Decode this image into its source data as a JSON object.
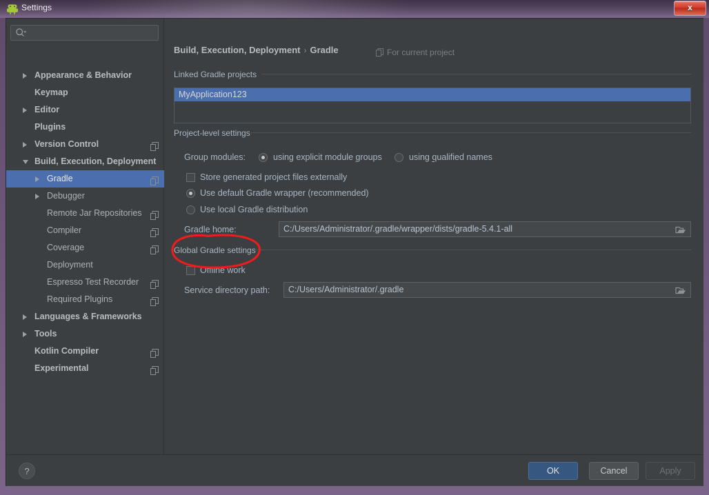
{
  "window": {
    "title": "Settings",
    "app_icon": "android-icon",
    "close_label": "x"
  },
  "sidebar": {
    "search": {
      "placeholder": "",
      "value": "",
      "icon": "search-icon"
    },
    "items": [
      {
        "label": "Appearance & Behavior",
        "indent": 0,
        "arrow": "right",
        "bold": true,
        "badge": false
      },
      {
        "label": "Keymap",
        "indent": 0,
        "arrow": "none",
        "bold": true,
        "badge": false
      },
      {
        "label": "Editor",
        "indent": 0,
        "arrow": "right",
        "bold": true,
        "badge": false
      },
      {
        "label": "Plugins",
        "indent": 0,
        "arrow": "none",
        "bold": true,
        "badge": false
      },
      {
        "label": "Version Control",
        "indent": 0,
        "arrow": "right",
        "bold": true,
        "badge": true
      },
      {
        "label": "Build, Execution, Deployment",
        "indent": 0,
        "arrow": "down",
        "bold": true,
        "badge": false
      },
      {
        "label": "Gradle",
        "indent": 1,
        "arrow": "right",
        "bold": false,
        "badge": true,
        "selected": true
      },
      {
        "label": "Debugger",
        "indent": 1,
        "arrow": "right",
        "bold": false,
        "badge": false
      },
      {
        "label": "Remote Jar Repositories",
        "indent": 1,
        "arrow": "none",
        "bold": false,
        "badge": true
      },
      {
        "label": "Compiler",
        "indent": 1,
        "arrow": "none",
        "bold": false,
        "badge": true
      },
      {
        "label": "Coverage",
        "indent": 1,
        "arrow": "none",
        "bold": false,
        "badge": true
      },
      {
        "label": "Deployment",
        "indent": 1,
        "arrow": "none",
        "bold": false,
        "badge": false
      },
      {
        "label": "Espresso Test Recorder",
        "indent": 1,
        "arrow": "none",
        "bold": false,
        "badge": true
      },
      {
        "label": "Required Plugins",
        "indent": 1,
        "arrow": "none",
        "bold": false,
        "badge": true
      },
      {
        "label": "Languages & Frameworks",
        "indent": 0,
        "arrow": "right",
        "bold": true,
        "badge": false
      },
      {
        "label": "Tools",
        "indent": 0,
        "arrow": "right",
        "bold": true,
        "badge": false
      },
      {
        "label": "Kotlin Compiler",
        "indent": 0,
        "arrow": "none",
        "bold": true,
        "badge": true
      },
      {
        "label": "Experimental",
        "indent": 0,
        "arrow": "none",
        "bold": true,
        "badge": true
      }
    ]
  },
  "main": {
    "breadcrumb_root": "Build, Execution, Deployment",
    "breadcrumb_sep": "›",
    "breadcrumb_leaf": "Gradle",
    "for_current_project": "For current project",
    "linked_projects_header": "Linked Gradle projects",
    "linked_projects": [
      "MyApplication123"
    ],
    "project_level_header": "Project-level settings",
    "group_modules_label": "Group modules:",
    "group_modules_options": [
      {
        "label_pre": "using explicit module ",
        "mnemonic": "g",
        "label_post": "roups",
        "checked": true
      },
      {
        "label_pre": "using ",
        "mnemonic": "q",
        "label_post": "ualified names",
        "checked": false
      }
    ],
    "store_generated_label": "Store generated project files externally",
    "store_generated_checked": false,
    "distribution_options": [
      {
        "label": "Use default Gradle wrapper (recommended)",
        "checked": true
      },
      {
        "label": "Use local Gradle distribution",
        "checked": false
      }
    ],
    "gradle_home_label": "Gradle home:",
    "gradle_home_value": "C:/Users/Administrator/.gradle/wrapper/dists/gradle-5.4.1-all",
    "global_settings_header": "Global Gradle settings",
    "offline_work_label": "Offline work",
    "offline_work_checked": false,
    "service_dir_label": "Service directory path:",
    "service_dir_value": "C:/Users/Administrator/.gradle"
  },
  "footer": {
    "help_label": "?",
    "ok_label": "OK",
    "cancel_label": "Cancel",
    "apply_label": "Apply"
  },
  "annotation": {
    "shape": "red-ellipse",
    "color": "#ee1c1c",
    "targets": "offline-work-checkbox"
  },
  "colors": {
    "selection_blue": "#4b6eaf",
    "primary_button": "#365880",
    "panel_bg": "#3c3f41",
    "field_bg": "#45484a",
    "text": "#a9b7c6",
    "titlebar_purple": "#6a5579",
    "annotation_red": "#ee1c1c"
  }
}
